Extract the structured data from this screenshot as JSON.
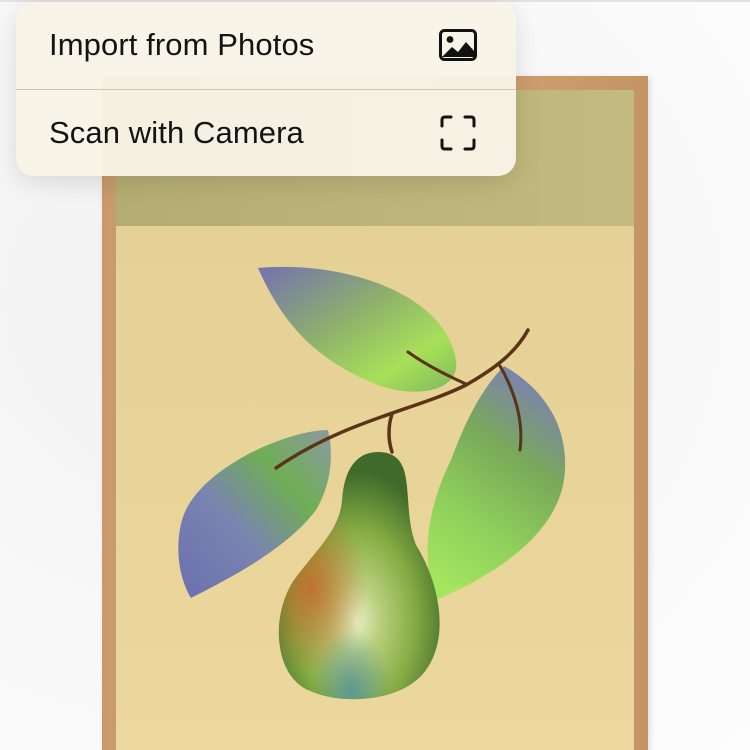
{
  "context_menu": {
    "items": [
      {
        "label": "Import from Photos",
        "icon": "photo-icon"
      },
      {
        "label": "Scan with Camera",
        "icon": "viewfinder-icon"
      }
    ]
  },
  "artwork": {
    "subject": "pear-with-leaves-icon",
    "colors": {
      "frame": "#cfa070",
      "mat_background": "#e9d49a",
      "top_band": "#b9b177",
      "leaf_green": "#8dc95a",
      "leaf_purple": "#7b79b3",
      "pear_green": "#8fb84a",
      "stem": "#5a3318"
    }
  }
}
